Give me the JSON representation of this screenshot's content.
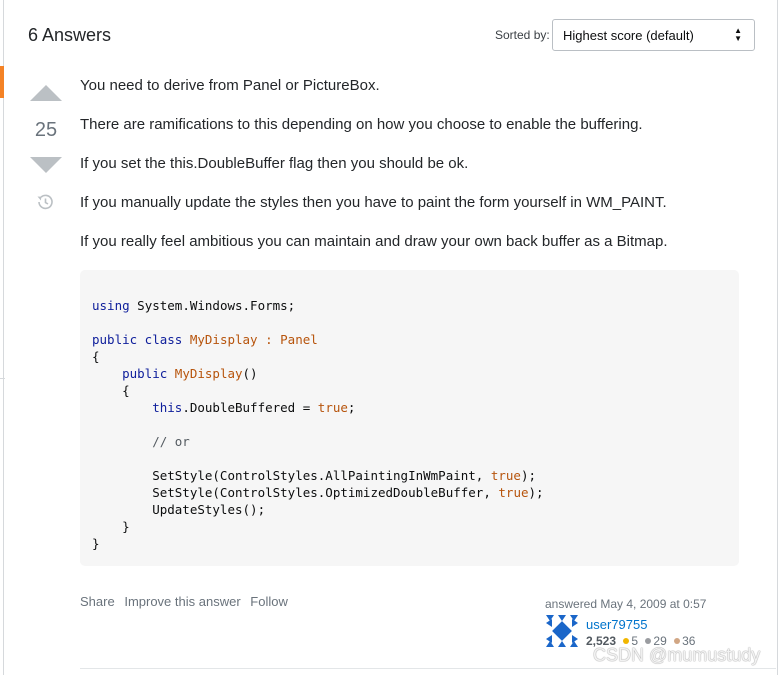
{
  "answers_header": "6 Answers",
  "sort": {
    "label": "Sorted by:",
    "selected": "Highest score (default)"
  },
  "vote": {
    "count": "25"
  },
  "post": {
    "paragraphs": [
      "You need to derive from Panel or PictureBox.",
      "There are ramifications to this depending on how you choose to enable the buffering.",
      "If you set the this.DoubleBuffer flag then you should be ok.",
      "If you manually update the styles then you have to paint the form yourself in WM_PAINT.",
      "If you really feel ambitious you can maintain and draw your own back buffer as a Bitmap."
    ],
    "code": {
      "l1_kw": "using",
      "l1_rest": " System.Windows.Forms;",
      "l3_kw": "public class",
      "l3_type": "MyDisplay",
      "l3_colon": " : ",
      "l3_base": "Panel",
      "l4": "{",
      "l5_indent": "    ",
      "l5_kw": "public",
      "l5_name": "MyDisplay",
      "l5_paren": "()",
      "l6": "    {",
      "l7_indent": "        ",
      "l7_kw": "this",
      "l7_rest": ".DoubleBuffered = ",
      "l7_val": "true",
      "l7_end": ";",
      "l9": "        // or",
      "l11_pre": "        SetStyle(ControlStyles.AllPaintingInWmPaint, ",
      "l11_val": "true",
      "l11_end": ");",
      "l12_pre": "        SetStyle(ControlStyles.OptimizedDoubleBuffer, ",
      "l12_val": "true",
      "l12_end": ");",
      "l13": "        UpdateStyles();",
      "l14": "    }",
      "l15": "}"
    }
  },
  "menu": {
    "share": "Share",
    "improve": "Improve this answer",
    "follow": "Follow"
  },
  "author": {
    "answered": "answered May 4, 2009 at 0:57",
    "name": "user79755",
    "reputation": "2,523",
    "gold": "5",
    "silver": "29",
    "bronze": "36"
  },
  "watermark": "CSDN @mumustudy",
  "colors": {
    "accent": "#f48225",
    "link": "#0074cc",
    "keyword": "#10209c",
    "type": "#b7540c"
  }
}
